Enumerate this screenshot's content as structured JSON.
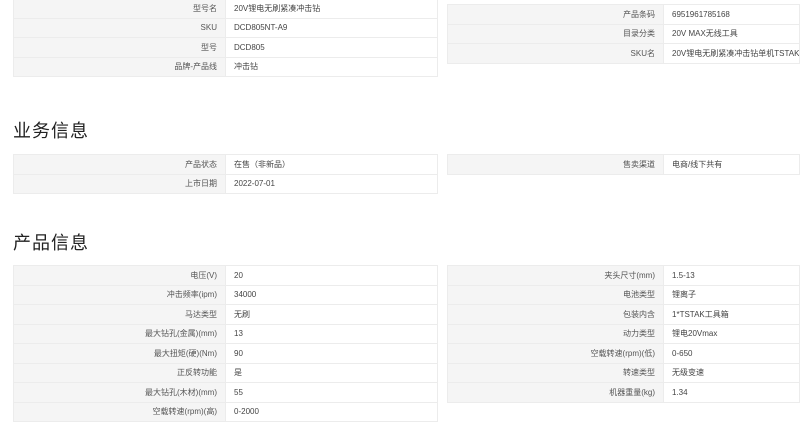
{
  "basic_left": [
    {
      "label": "型号名",
      "value": "20V锂电无刷紧凑冲击钻"
    },
    {
      "label": "SKU",
      "value": "DCD805NT-A9"
    },
    {
      "label": "型号",
      "value": "DCD805"
    },
    {
      "label": "品牌-产品线",
      "value": "冲击钻"
    }
  ],
  "basic_right": [
    {
      "label": "产品条码",
      "value": "6951961785168"
    },
    {
      "label": "目录分类",
      "value": "20V MAX无线工具"
    },
    {
      "label": "SKU名",
      "value": "20V锂电无刷紧凑冲击钻单机TSTAK"
    }
  ],
  "business": {
    "heading": "业务信息",
    "left": [
      {
        "label": "产品状态",
        "value": "在售（非新品）"
      },
      {
        "label": "上市日期",
        "value": "2022-07-01"
      }
    ],
    "right": [
      {
        "label": "售卖渠道",
        "value": "电商/线下共有"
      }
    ]
  },
  "product": {
    "heading": "产品信息",
    "left": [
      {
        "label": "电压(V)",
        "value": "20"
      },
      {
        "label": "冲击频率(ipm)",
        "value": "34000"
      },
      {
        "label": "马达类型",
        "value": "无刷"
      },
      {
        "label": "最大钻孔(金属)(mm)",
        "value": "13"
      },
      {
        "label": "最大扭矩(硬)(Nm)",
        "value": "90"
      },
      {
        "label": "正反转功能",
        "value": "是"
      },
      {
        "label": "最大钻孔(木材)(mm)",
        "value": "55"
      },
      {
        "label": "空载转速(rpm)(高)",
        "value": "0-2000"
      }
    ],
    "right": [
      {
        "label": "夹头尺寸(mm)",
        "value": "1.5-13"
      },
      {
        "label": "电池类型",
        "value": "锂离子"
      },
      {
        "label": "包装内含",
        "value": "1*TSTAK工具箱"
      },
      {
        "label": "动力类型",
        "value": "锂电20Vmax"
      },
      {
        "label": "空载转速(rpm)(低)",
        "value": "0-650"
      },
      {
        "label": "转速类型",
        "value": "无级变速"
      },
      {
        "label": "机器重量(kg)",
        "value": "1.34"
      }
    ]
  }
}
